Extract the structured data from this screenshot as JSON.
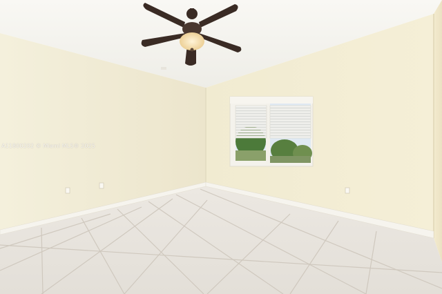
{
  "photo": {
    "watermark": "A11800202 © Miami MLS® 2025",
    "colors": {
      "ceiling": "#f7f6f1",
      "left_wall": "#f1ecd6",
      "back_wall": "#f3edd4",
      "right_wall": "#efe6c8",
      "floor": "#e8e4de",
      "grout": "#c9c2b8",
      "baseboard": "#f7f6f3",
      "fan_blade": "#3a2b24",
      "fan_light": "#f5d9a0",
      "blinds": "#f2f2f0",
      "foliage": "#4c7a3a",
      "sky": "#dfe9f2"
    }
  }
}
